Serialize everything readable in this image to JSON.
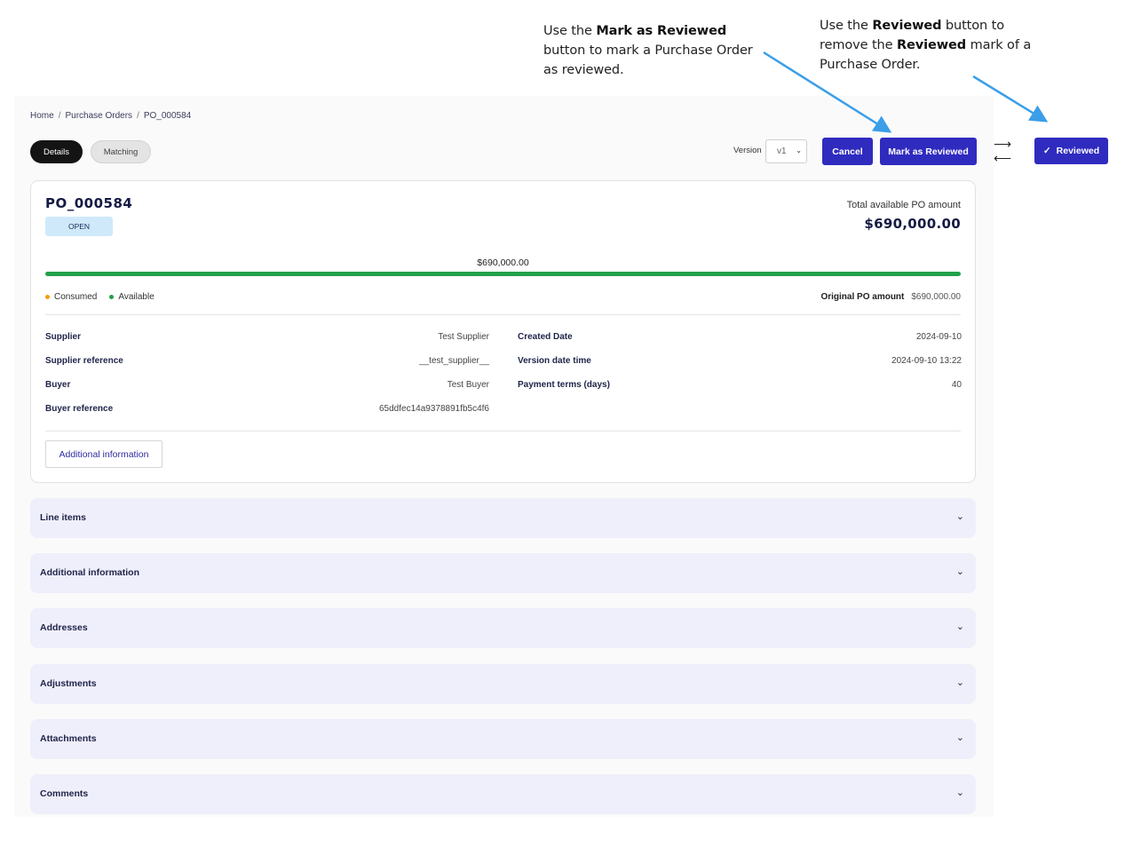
{
  "annotations": {
    "mark": {
      "t1": "Use the ",
      "b1": "Mark as Reviewed",
      "t2": " button to mark a Purchase Order as reviewed."
    },
    "reviewed": {
      "t1": "Use the ",
      "b1": "Reviewed",
      "t2": " button to remove the ",
      "b2": "Reviewed",
      "t3": " mark of a Purchase Order."
    }
  },
  "breadcrumb": [
    "Home",
    "Purchase Orders",
    "PO_000584"
  ],
  "tabs": [
    "Details",
    "Matching"
  ],
  "toolbar": {
    "version_label": "Version",
    "version_value": "v1",
    "cancel_label": "Cancel",
    "mark_label": "Mark as Reviewed",
    "reviewed_label": "Reviewed"
  },
  "po": {
    "id": "PO_000584",
    "status": "OPEN",
    "total_label": "Total available PO amount",
    "total_value": "$690,000.00",
    "progress_label": "$690,000.00",
    "available_fraction": 1.0,
    "legend": [
      {
        "label": "Consumed",
        "color": "#f59e0b"
      },
      {
        "label": "Available",
        "color": "#22a04a"
      }
    ],
    "original_label": "Original PO amount",
    "original_value": "$690,000.00",
    "fields_left": [
      {
        "label": "Supplier",
        "value": "Test Supplier"
      },
      {
        "label": "Supplier reference",
        "value": "__test_supplier__"
      },
      {
        "label": "Buyer",
        "value": "Test Buyer"
      },
      {
        "label": "Buyer reference",
        "value": "65ddfec14a9378891fb5c4f6"
      }
    ],
    "fields_right": [
      {
        "label": "Created Date",
        "value": "2024-09-10"
      },
      {
        "label": "Version date time",
        "value": "2024-09-10 13:22"
      },
      {
        "label": "Payment terms (days)",
        "value": "40"
      }
    ],
    "additional_button": "Additional information"
  },
  "sections": [
    "Line items",
    "Additional information",
    "Addresses",
    "Adjustments",
    "Attachments",
    "Comments"
  ],
  "colors": {
    "primary": "#2f2bbf",
    "annotation_arrow": "#3b9ee8",
    "progress": "#22a04a"
  }
}
